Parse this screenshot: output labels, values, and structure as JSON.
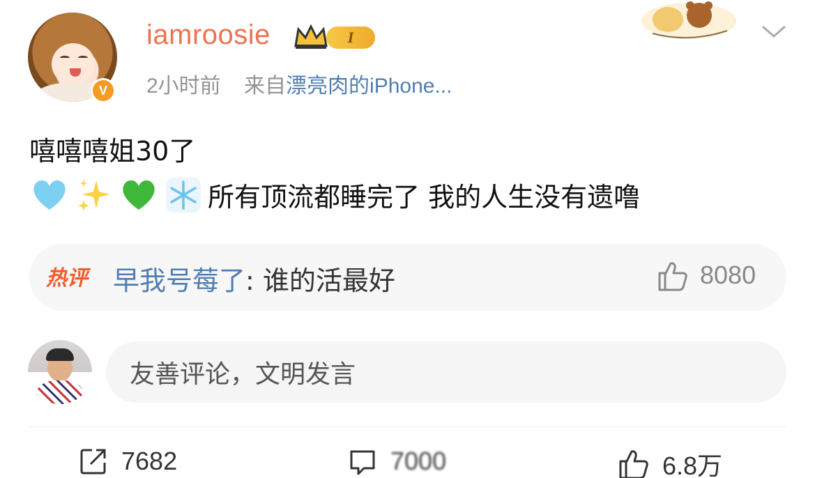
{
  "post": {
    "username": "iamroosie",
    "level": "I",
    "time": "2小时前",
    "source_prefix": "来自",
    "source": "漂亮肉的iPhone...",
    "verified": "V",
    "text_line1": "嘻嘻嘻姐30了",
    "text_line2": "所有顶流都睡完了 我的人生没有遗噜",
    "emojis": [
      "light-blue-heart",
      "sparkles",
      "green-heart",
      "snowflake"
    ]
  },
  "hot_comment": {
    "label": "热评",
    "commenter": "早我号莓了",
    "separator": ": ",
    "text": "谁的活最好",
    "likes": "8080"
  },
  "comment_box": {
    "placeholder": "友善评论，文明发言"
  },
  "actions": {
    "repost_count": "7682",
    "comment_count": "7000",
    "like_count": "6.8万"
  },
  "colors": {
    "username": "#eb7350",
    "link": "#507daf",
    "hot_label": "#f25c2a",
    "meta": "#939393"
  }
}
